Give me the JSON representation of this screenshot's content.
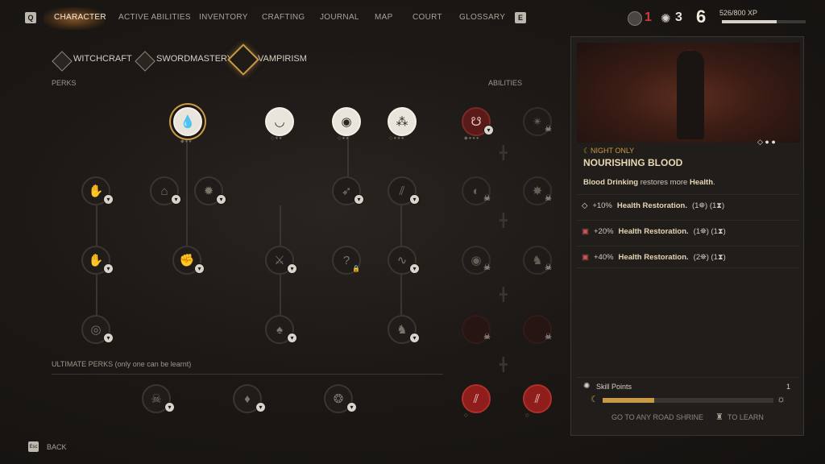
{
  "topbar": {
    "left_key": "Q",
    "right_key": "E",
    "tabs": [
      "CHARACTER",
      "ACTIVE ABILITIES",
      "INVENTORY",
      "CRAFTING",
      "JOURNAL",
      "MAP",
      "COURT",
      "GLOSSARY"
    ],
    "stat_red": "1",
    "stat_white": "3",
    "level": "6",
    "xp_text": "526/800 XP",
    "xp_progress": 0.6575
  },
  "subtabs": [
    "WITCHCRAFT",
    "SWORDMASTERY",
    "VAMPIRISM"
  ],
  "labels": {
    "perks": "PERKS",
    "abilities": "ABILITIES",
    "ultimate": "ULTIMATE PERKS (only one can be learnt)"
  },
  "detail": {
    "tag": "NIGHT ONLY",
    "title": "NOURISHING BLOOD",
    "desc_bold": "Blood Drinking",
    "desc_mid": " restores more ",
    "desc_health": "Health",
    "desc_end": ".",
    "effects": [
      {
        "pct": "+10%",
        "label": "Health Restoration.",
        "cost": "(1⛯) (1⧗)"
      },
      {
        "pct": "+20%",
        "label": "Health Restoration.",
        "cost": "(1⛯) (1⧗)"
      },
      {
        "pct": "+40%",
        "label": "Health Restoration.",
        "cost": "(2⛯) (1⧗)"
      }
    ],
    "skill_points_label": "Skill Points",
    "skill_points_value": "1",
    "time_progress": 0.3,
    "shrine_text_a": "GO TO ANY ROAD SHRINE",
    "shrine_text_b": "TO LEARN"
  },
  "footer": {
    "key": "Esc",
    "back": "BACK"
  },
  "colors": {
    "gold": "#c99a45",
    "red_stat": "#d23a3a",
    "blood": "#8e1d1b"
  }
}
